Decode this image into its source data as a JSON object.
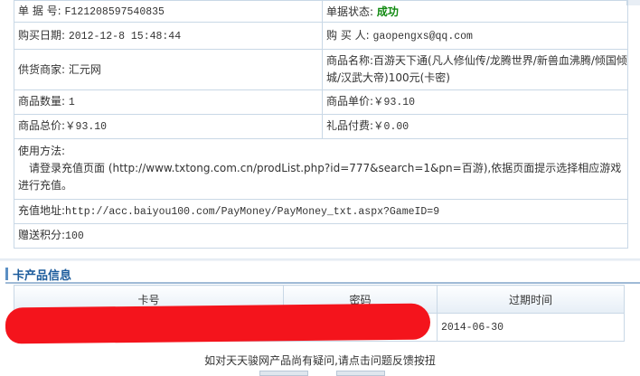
{
  "order": {
    "order_no_label": "单 据 号:",
    "order_no": "F121208597540835",
    "status_label": "单据状态:",
    "status": "成功",
    "buy_date_label": "购买日期:",
    "buy_date": "2012-12-8 15:48:44",
    "buyer_label": "购 买 人:",
    "buyer": "gaopengxs@qq.com",
    "supplier_label": "供货商家:",
    "supplier": "汇元网",
    "product_name_label": "商品名称:",
    "product_name": "百游天下通(凡人修仙传/龙腾世界/新兽血沸腾/倾国倾城/汉武大帝)100元(卡密)",
    "quantity_label": "商品数量:",
    "quantity": "1",
    "unit_price_label": "商品单价:",
    "unit_price": "￥93.10",
    "total_label": "商品总价:",
    "total": "￥93.10",
    "gift_fee_label": "礼品付费:",
    "gift_fee": "￥0.00",
    "usage_label": "使用方法:",
    "usage_text": "请登录充值页面 (http://www.txtong.com.cn/prodList.php?id=777&search=1&pn=百游),依据页面提示选择相应游戏进行充值。",
    "recharge_label": "充值地址:",
    "recharge_url": "http://acc.baiyou100.com/PayMoney/PayMoney_txt.aspx?GameID=9",
    "points_label": "赠送积分:",
    "points": "100"
  },
  "cards": {
    "section_title": "卡产品信息",
    "headers": [
      "卡号",
      "密码",
      "过期时间"
    ],
    "rows": [
      {
        "card_no": "",
        "password": "",
        "expires": "2014-06-30"
      }
    ]
  },
  "footer": {
    "note": "如对天天骏网产品尚有疑问,请点击问题反馈按扭"
  },
  "colors": {
    "status_success": "#118a11",
    "border": "#c9d8e6",
    "section_title": "#1d5c9c",
    "redaction": "#f4141c"
  }
}
